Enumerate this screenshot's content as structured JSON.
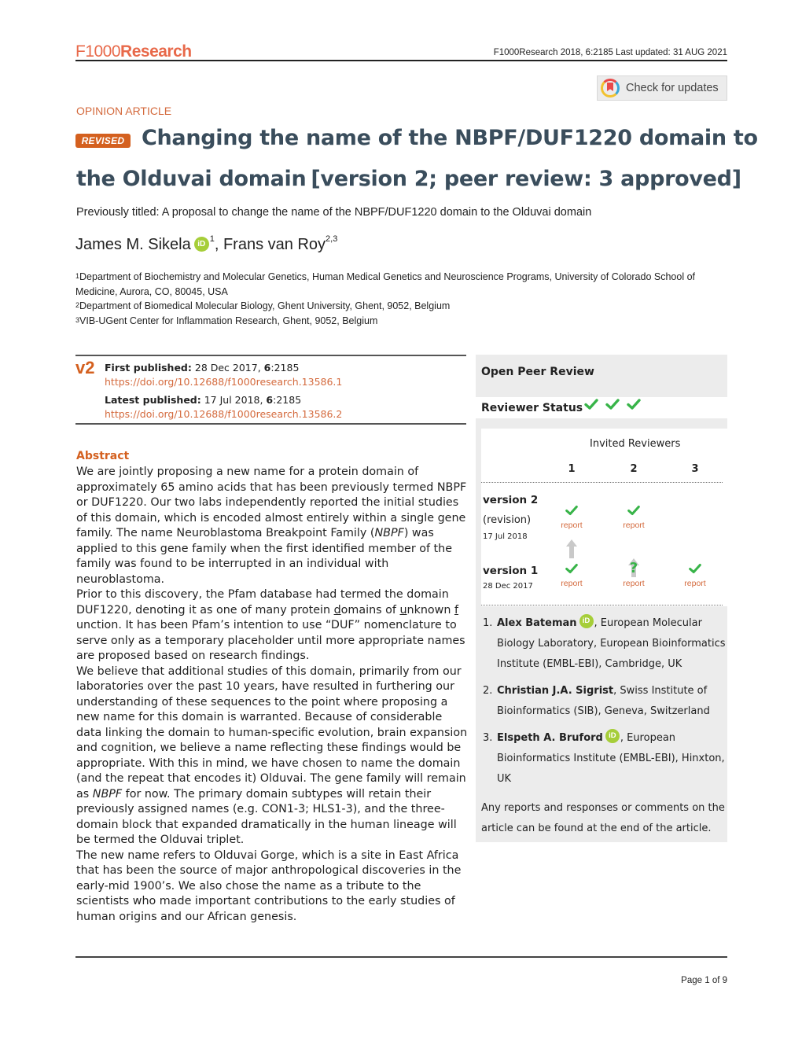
{
  "header": {
    "logo_part1": "F1000",
    "logo_part2": "Research",
    "citation": "F1000Research 2018, 6:2185 Last updated: 31 AUG 2021",
    "check_updates_label": "Check for updates",
    "brand_color": "#e8694a"
  },
  "article": {
    "type": "OPINION ARTICLE",
    "revised_badge": "REVISED",
    "title_line1": "Changing the name of the NBPF/DUF1220 domain to",
    "title_line2": "the Olduvai domain",
    "version_status": "[version 2; peer review: 3 approved]",
    "previously_titled": "Previously titled: A proposal to change the name of the NBPF/DUF1220 domain to the Olduvai domain",
    "authors": [
      {
        "name": "James M. Sikela",
        "orcid": true,
        "affil": "1"
      },
      {
        "name": "Frans van Roy",
        "orcid": false,
        "affil": "2,3"
      }
    ],
    "author_separator": ", ",
    "orcid_label": "iD",
    "affiliations": [
      {
        "num": "1",
        "text": "Department of Biochemistry and Molecular Genetics, Human Medical Genetics and Neuroscience Programs, University of Colorado School of Medicine, Aurora, CO, 80045, USA"
      },
      {
        "num": "2",
        "text": "Department of Biomedical Molecular Biology, Ghent University, Ghent, 9052, Belgium"
      },
      {
        "num": "3",
        "text": "VIB-UGent Center for Inflammation Research, Ghent, 9052, Belgium"
      }
    ]
  },
  "publication": {
    "version_label": "v2",
    "first_published_label": "First published:",
    "first_published_date": " 28 Dec 2017, ",
    "first_published_vol": "6",
    "first_published_id": ":2185",
    "first_doi": "https://doi.org/10.12688/f1000research.13586.1",
    "latest_published_label": "Latest published:",
    "latest_published_date": " 17 Jul 2018, ",
    "latest_published_vol": "6",
    "latest_published_id": ":2185",
    "latest_doi": "https://doi.org/10.12688/f1000research.13586.2"
  },
  "abstract": {
    "heading": "Abstract",
    "p1_a": "We are jointly proposing a new name for a protein domain of approximately 65 amino acids that has been previously termed NBPF or DUF1220. Our two labs independently reported the initial studies of this domain, which is encoded almost entirely within a single gene family. The name Neuroblastoma Breakpoint Family (",
    "p1_italic": "NBPF",
    "p1_b": ") was applied to this gene family when the first identified member of the family was found to be interrupted in an individual with neuroblastoma.",
    "p2_a": "Prior to this discovery, the Pfam database had termed the domain DUF1220, denoting it as one of many protein ",
    "p2_d": "d",
    "p2_b": "omains of ",
    "p2_u": "u",
    "p2_c": "nknown ",
    "p2_f": "f",
    "p2_e": " unction. It has been Pfam’s intention to use “DUF” nomenclature to serve only as a temporary placeholder until more appropriate names are proposed based on research findings.",
    "p3_a": "We believe that additional studies of this domain, primarily from our laboratories over the past 10 years, have resulted in furthering our understanding of these sequences to the point where proposing a new name for this domain is warranted. Because of considerable data linking the domain to human-specific evolution, brain expansion and cognition, we believe a name reflecting these findings would be appropriate. With this in mind, we have chosen to name the domain (and the repeat that encodes it) Olduvai. The gene family will remain as ",
    "p3_italic": "NBPF",
    "p3_b": " for now. The primary domain subtypes will retain their previously assigned names (e.g. CON1-3; HLS1-3), and the three-domain block that expanded dramatically in the human lineage will be termed the Olduvai triplet.",
    "p4": "The new name refers to Olduvai Gorge, which is a site in East Africa that has been the source of major anthropological discoveries in the early-mid 1900’s. We also chose the name as a tribute to the scientists who made important contributions to the early studies of human origins and our African genesis."
  },
  "peer_review": {
    "title": "Open Peer Review",
    "reviewer_status_label": "Reviewer Status",
    "status_checks": 3,
    "invited_label": "Invited Reviewers",
    "columns": [
      "1",
      "2",
      "3"
    ],
    "versions": [
      {
        "label": "version 2",
        "sub": "(revision)",
        "date": "17 Jul 2018",
        "reviews": [
          "approved",
          "approved",
          ""
        ]
      },
      {
        "label": "version 1",
        "sub": "",
        "date": "28 Dec 2017",
        "reviews": [
          "approved",
          "approved-with-reservations",
          "approved"
        ]
      }
    ],
    "report_label": "report",
    "question_glyph": "?",
    "reviewers": [
      {
        "num": "1.",
        "name": "Alex Bateman",
        "orcid": true,
        "affil": ", European Molecular Biology Laboratory, European Bioinformatics Institute (EMBL-EBI), Cambridge, UK"
      },
      {
        "num": "2.",
        "name": "Christian J.A. Sigrist",
        "orcid": false,
        "affil": ", Swiss Institute of Bioinformatics (SIB), Geneva, Switzerland"
      },
      {
        "num": "3.",
        "name": "Elspeth A. Bruford",
        "orcid": true,
        "affil": ", European Bioinformatics Institute (EMBL-EBI), Hinxton, UK"
      }
    ],
    "note": "Any reports and responses or comments on the article can be found at the end of the article.",
    "approved_color": "#38b449",
    "link_color": "#d46a3d"
  },
  "footer": {
    "page": "Page 1 of 9"
  }
}
